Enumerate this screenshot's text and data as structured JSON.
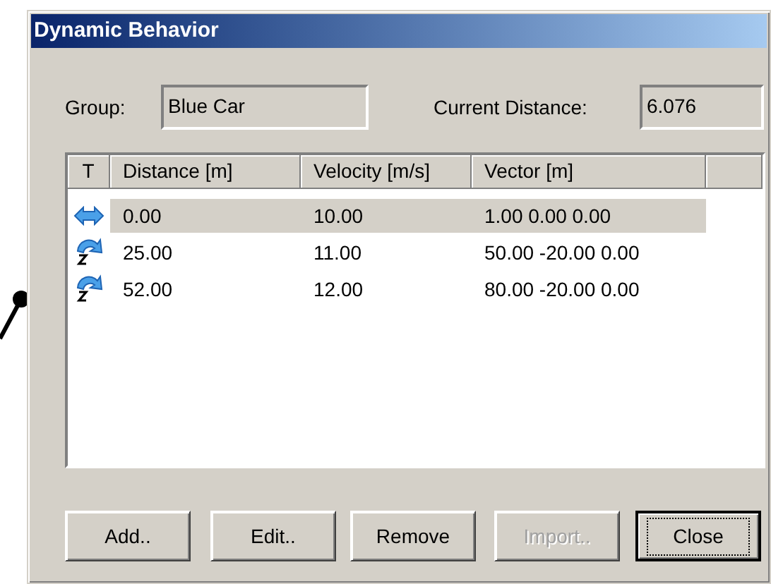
{
  "window": {
    "title": "Dynamic Behavior"
  },
  "group": {
    "label": "Group:",
    "value": "Blue Car"
  },
  "current_distance": {
    "label": "Current Distance:",
    "value": "6.076"
  },
  "table": {
    "columns": [
      "T",
      "Distance [m]",
      "Velocity [m/s]",
      "Vector [m]"
    ],
    "rows": [
      {
        "kind": "translate",
        "selected": true,
        "cells": [
          "",
          "0.00",
          "10.00",
          "1.00 0.00 0.00"
        ]
      },
      {
        "kind": "rotate",
        "selected": false,
        "cells": [
          "",
          "25.00",
          "11.00",
          "50.00 -20.00 0.00"
        ]
      },
      {
        "kind": "rotate",
        "selected": false,
        "cells": [
          "",
          "52.00",
          "12.00",
          "80.00 -20.00 0.00"
        ]
      }
    ]
  },
  "buttons": [
    {
      "label": "Add..",
      "disabled": false,
      "default": false
    },
    {
      "label": "Edit..",
      "disabled": false,
      "default": false
    },
    {
      "label": "Remove",
      "disabled": false,
      "default": false
    },
    {
      "label": "Import..",
      "disabled": true,
      "default": false
    },
    {
      "label": "Close",
      "disabled": false,
      "default": true
    }
  ]
}
